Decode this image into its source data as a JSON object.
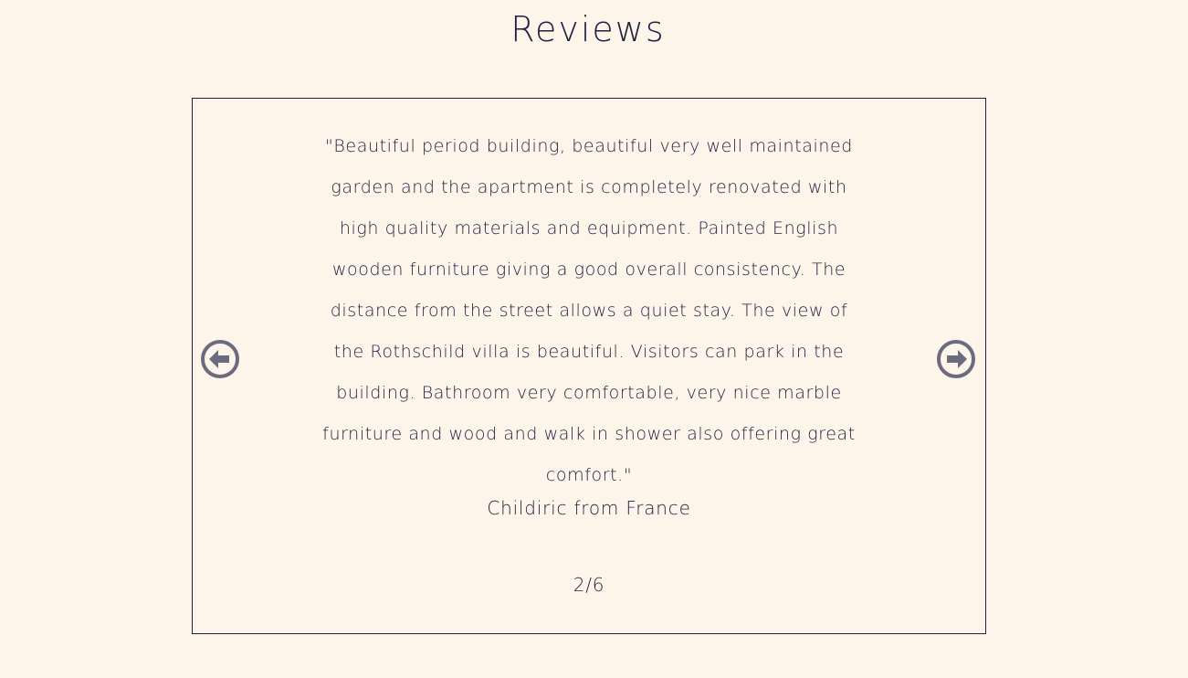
{
  "header": {
    "title": "Reviews"
  },
  "review": {
    "quote": "\"Beautiful period building, beautiful very well maintained garden and the apartment is completely renovated with high quality materials and equipment. Painted English wooden furniture giving a good overall consistency. The distance from the street allows a quiet stay. The view of the Rothschild villa is beautiful. Visitors can park in the building. Bathroom very comfortable, very nice marble furniture and wood and walk in shower also offering great comfort.\"",
    "author": "Childiric from France",
    "counter": "2/6"
  },
  "navigation": {
    "prev_icon": "arrow-left-circle-icon",
    "next_icon": "arrow-right-circle-icon"
  },
  "colors": {
    "background": "#fdf4ea",
    "text": "#1e2140",
    "icon": "#6b6b80"
  }
}
